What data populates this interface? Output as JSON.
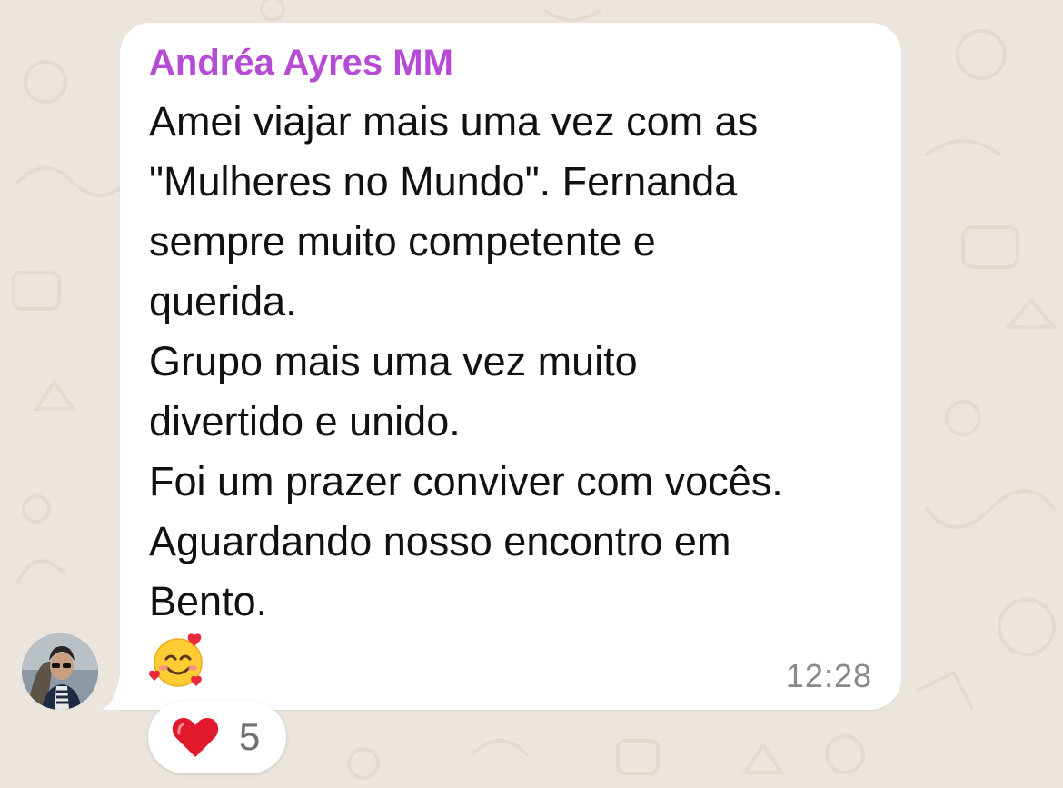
{
  "chat": {
    "message": {
      "sender": "Andréa Ayres MM",
      "sender_color": "#b64bd6",
      "lines": [
        "Amei viajar mais uma vez com as",
        "\"Mulheres no Mundo\". Fernanda",
        "sempre muito competente e",
        "querida.",
        "Grupo mais uma vez muito",
        "divertido e unido.",
        "Foi um prazer conviver com vocês.",
        "Aguardando nosso encontro em",
        "Bento."
      ],
      "emoji": "smiling-face-with-hearts-icon",
      "time": "12:28"
    },
    "reaction": {
      "emoji": "red-heart-icon",
      "count": "5"
    },
    "colors": {
      "wallpaper": "#ebe5dd",
      "bubble": "#ffffff",
      "text": "#111111",
      "timestamp": "#8a8a8a"
    }
  }
}
